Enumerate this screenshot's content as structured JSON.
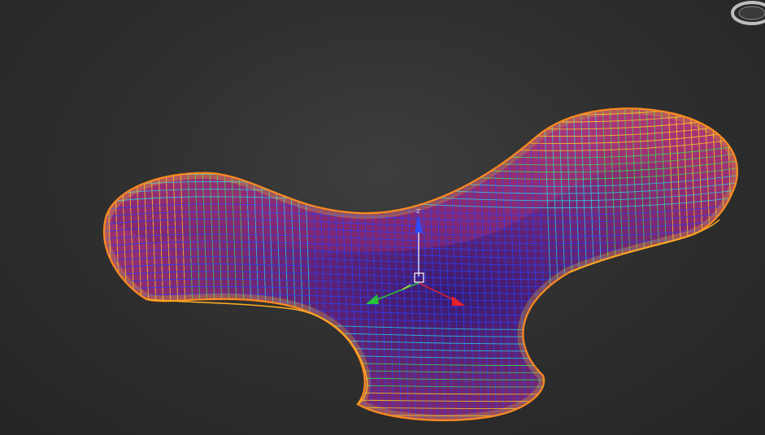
{
  "viewport": {
    "object_colors": {
      "surface": "#9a2f73",
      "surface_shade": "#5a1f63",
      "hole_inner": "#3a1760",
      "rim": "#ff8a1e",
      "wire_yellow": "#ffd21a",
      "wire_green": "#35e24c",
      "wire_cyan": "#22d6ef",
      "wire_blue": "#2542ff"
    },
    "gizmo": {
      "z_label": "Z",
      "x_axis_color": "#e8202a",
      "y_axis_color": "#27c23a",
      "z_axis_color": "#2d4bff"
    },
    "viewcube_icon": "viewcube-icon"
  }
}
